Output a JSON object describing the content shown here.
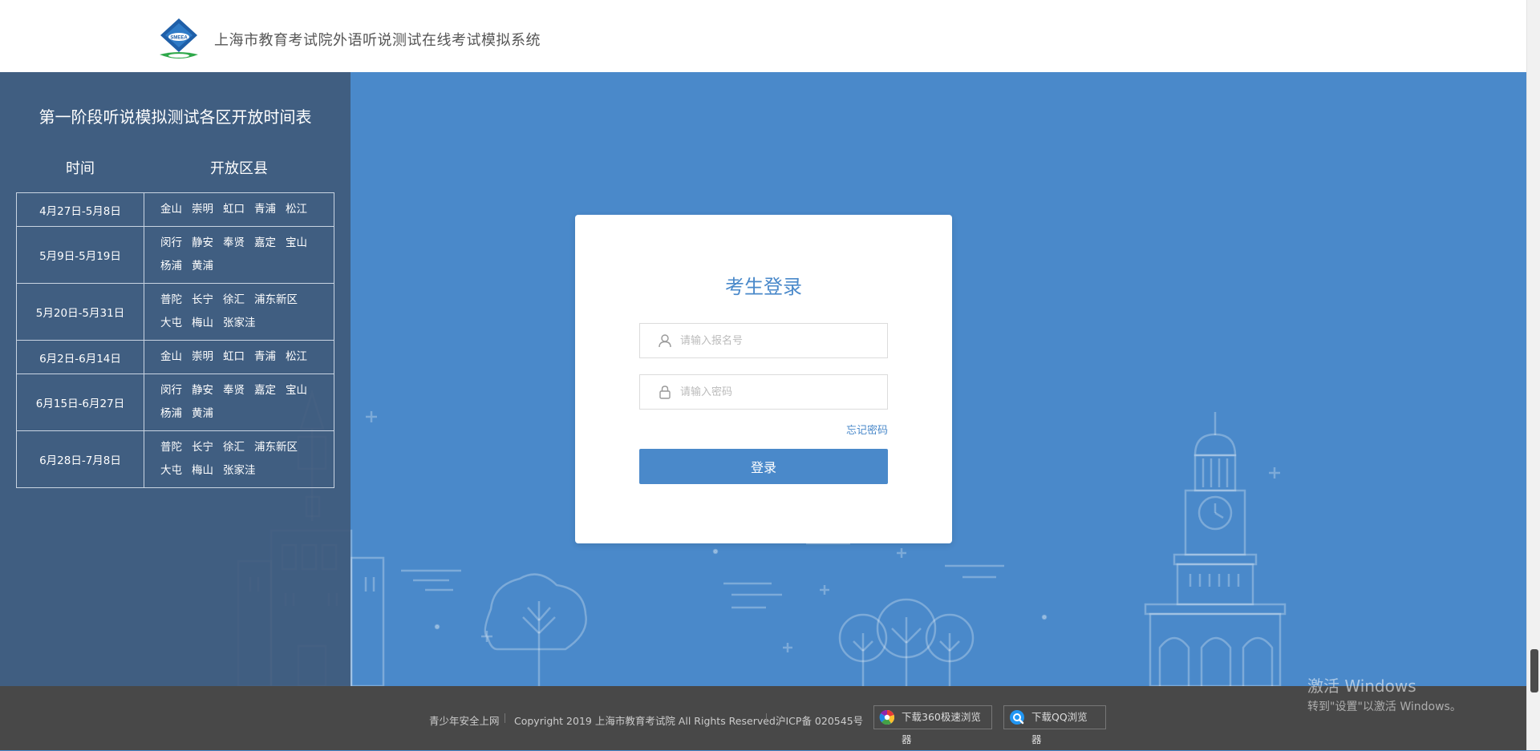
{
  "header": {
    "site_title": "上海市教育考试院外语听说测试在线考试模拟系统",
    "logo_text": "SMEEA"
  },
  "schedule": {
    "title": "第一阶段听说模拟测试各区开放时间表",
    "col_time": "时间",
    "col_districts": "开放区县",
    "rows": [
      {
        "time": "4月27日-5月8日",
        "districts": [
          "金山",
          "崇明",
          "虹口",
          "青浦",
          "松江"
        ]
      },
      {
        "time": "5月9日-5月19日",
        "districts": [
          "闵行",
          "静安",
          "奉贤",
          "嘉定",
          "宝山",
          "杨浦",
          "黄浦"
        ]
      },
      {
        "time": "5月20日-5月31日",
        "districts": [
          "普陀",
          "长宁",
          "徐汇",
          "浦东新区",
          "大屯",
          "梅山",
          "张家洼"
        ]
      },
      {
        "time": "6月2日-6月14日",
        "districts": [
          "金山",
          "崇明",
          "虹口",
          "青浦",
          "松江"
        ]
      },
      {
        "time": "6月15日-6月27日",
        "districts": [
          "闵行",
          "静安",
          "奉贤",
          "嘉定",
          "宝山",
          "杨浦",
          "黄浦"
        ]
      },
      {
        "time": "6月28日-7月8日",
        "districts": [
          "普陀",
          "长宁",
          "徐汇",
          "浦东新区",
          "大屯",
          "梅山",
          "张家洼"
        ]
      }
    ]
  },
  "login": {
    "title": "考生登录",
    "username_placeholder": "请输入报名号",
    "password_placeholder": "请输入密码",
    "forgot_label": "忘记密码",
    "submit_label": "登录"
  },
  "footer": {
    "safe_link": "青少年安全上网",
    "copyright": "Copyright 2019 上海市教育考试院 All Rights Reserved.",
    "icp": "沪ICP备 020545号",
    "download_360": "下载360极速浏览器",
    "download_qq": "下载QQ浏览器"
  },
  "os_overlay": {
    "line1": "激活 Windows",
    "line2": "转到\"设置\"以激活 Windows。"
  },
  "colors": {
    "primary": "#4a89ca",
    "left_panel": "#3f5a7b",
    "footer_bg": "#484848"
  }
}
